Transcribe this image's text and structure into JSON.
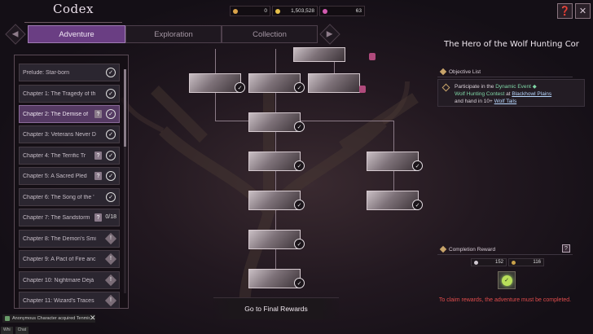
{
  "header": {
    "title": "Codex",
    "currencies": [
      {
        "icon": "quill-icon",
        "value": "0",
        "color": "#d9a34a"
      },
      {
        "icon": "gold-coin-icon",
        "value": "1,503,528",
        "color": "#e6c04a"
      },
      {
        "icon": "gem-icon",
        "value": "63",
        "color": "#d25bb0"
      }
    ],
    "icons": [
      "codex-book-icon",
      "close-icon"
    ]
  },
  "tabs": [
    {
      "label": "Adventure",
      "active": true
    },
    {
      "label": "Exploration",
      "active": false
    },
    {
      "label": "Collection",
      "active": false
    }
  ],
  "chapters": [
    {
      "label": "Prelude: Star-born",
      "status": "done"
    },
    {
      "label": "Chapter 1: The Tragedy of th",
      "status": "done"
    },
    {
      "label": "Chapter 2: The Demise of",
      "status": "done-question",
      "active": true
    },
    {
      "label": "Chapter 3: Veterans Never D",
      "status": "done"
    },
    {
      "label": "Chapter 4: The Terrific Tr",
      "status": "done-question"
    },
    {
      "label": "Chapter 5: A Sacred Pled",
      "status": "done-question"
    },
    {
      "label": "Chapter 6: The Song of the '",
      "status": "done"
    },
    {
      "label": "Chapter 7: The Sandstorm",
      "status": "progress",
      "progress": "0/18"
    },
    {
      "label": "Chapter 8: The Demon's Smi",
      "status": "locked"
    },
    {
      "label": "Chapter 9: A Pact of Fire anc",
      "status": "locked"
    },
    {
      "label": "Chapter 10: Nightmare Déjà",
      "status": "locked"
    },
    {
      "label": "Chapter 11: Wizard's Traces",
      "status": "locked"
    }
  ],
  "quest": {
    "title": "The Hero of the Wolf Hunting Cor",
    "objective_header": "Objective List",
    "objective": {
      "t1": "Participate in the ",
      "event": "Dynamic Event",
      "t2": "Wolf Hunting Contest",
      "t3": " at ",
      "place": "Blackhowl Plains",
      "t4": "and hand in 10+ ",
      "item": "Wolf Tails"
    },
    "reward_header": "Completion Reward",
    "rewards": [
      {
        "icon": "exp-icon",
        "value": "152"
      },
      {
        "icon": "coin-icon",
        "value": "116"
      }
    ],
    "reward_note": "To claim rewards, the adventure must be completed."
  },
  "final_button": "Go to Final Rewards",
  "chat": {
    "message": "Anonymous Character acquired  Tenmir...",
    "tabs": [
      "Whi",
      "Chat"
    ]
  }
}
